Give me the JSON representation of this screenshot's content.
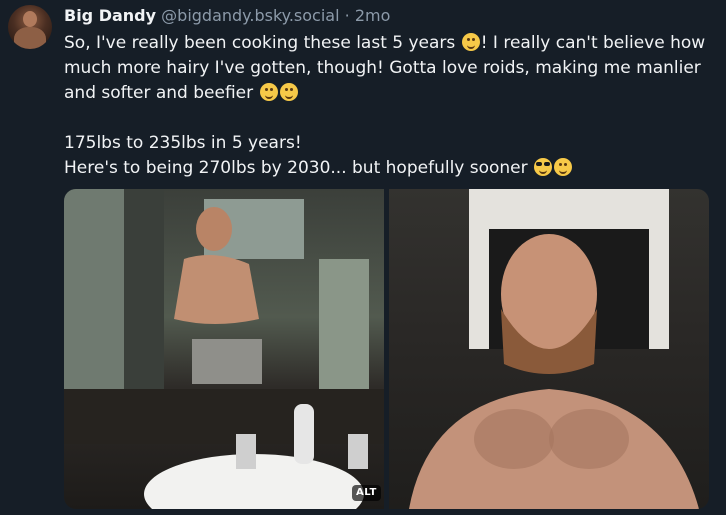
{
  "post": {
    "author": {
      "display_name": "Big Dandy",
      "handle": "@bigdandy.bsky.social",
      "separator": "·",
      "timestamp": "2mo",
      "avatar_icon": "user-avatar"
    },
    "text": {
      "line1_a": "So, I've really been cooking these last 5 years ",
      "line1_b": "! I really can't believe how much more hairy I've gotten, though! Gotta love roids, making me manlier and softer and beefier ",
      "line2": "175lbs to 235lbs in 5 years!",
      "line3": "Here's to being 270lbs by 2030... but hopefully sooner "
    },
    "emoji": {
      "first": "smiling-face-emoji",
      "second": "smiling-blush-emoji",
      "third": "grinning-face-emoji",
      "fourth": "sunglasses-emoji",
      "fifth": "drooling-face-emoji"
    },
    "images": [
      {
        "name": "before-photo",
        "alt_badge": "ALT"
      },
      {
        "name": "after-photo"
      }
    ]
  },
  "colors": {
    "background": "#161e27",
    "primary_text": "#f1f3f5",
    "secondary_text": "#8c9aa9",
    "emoji_yellow": "#f7c948"
  }
}
